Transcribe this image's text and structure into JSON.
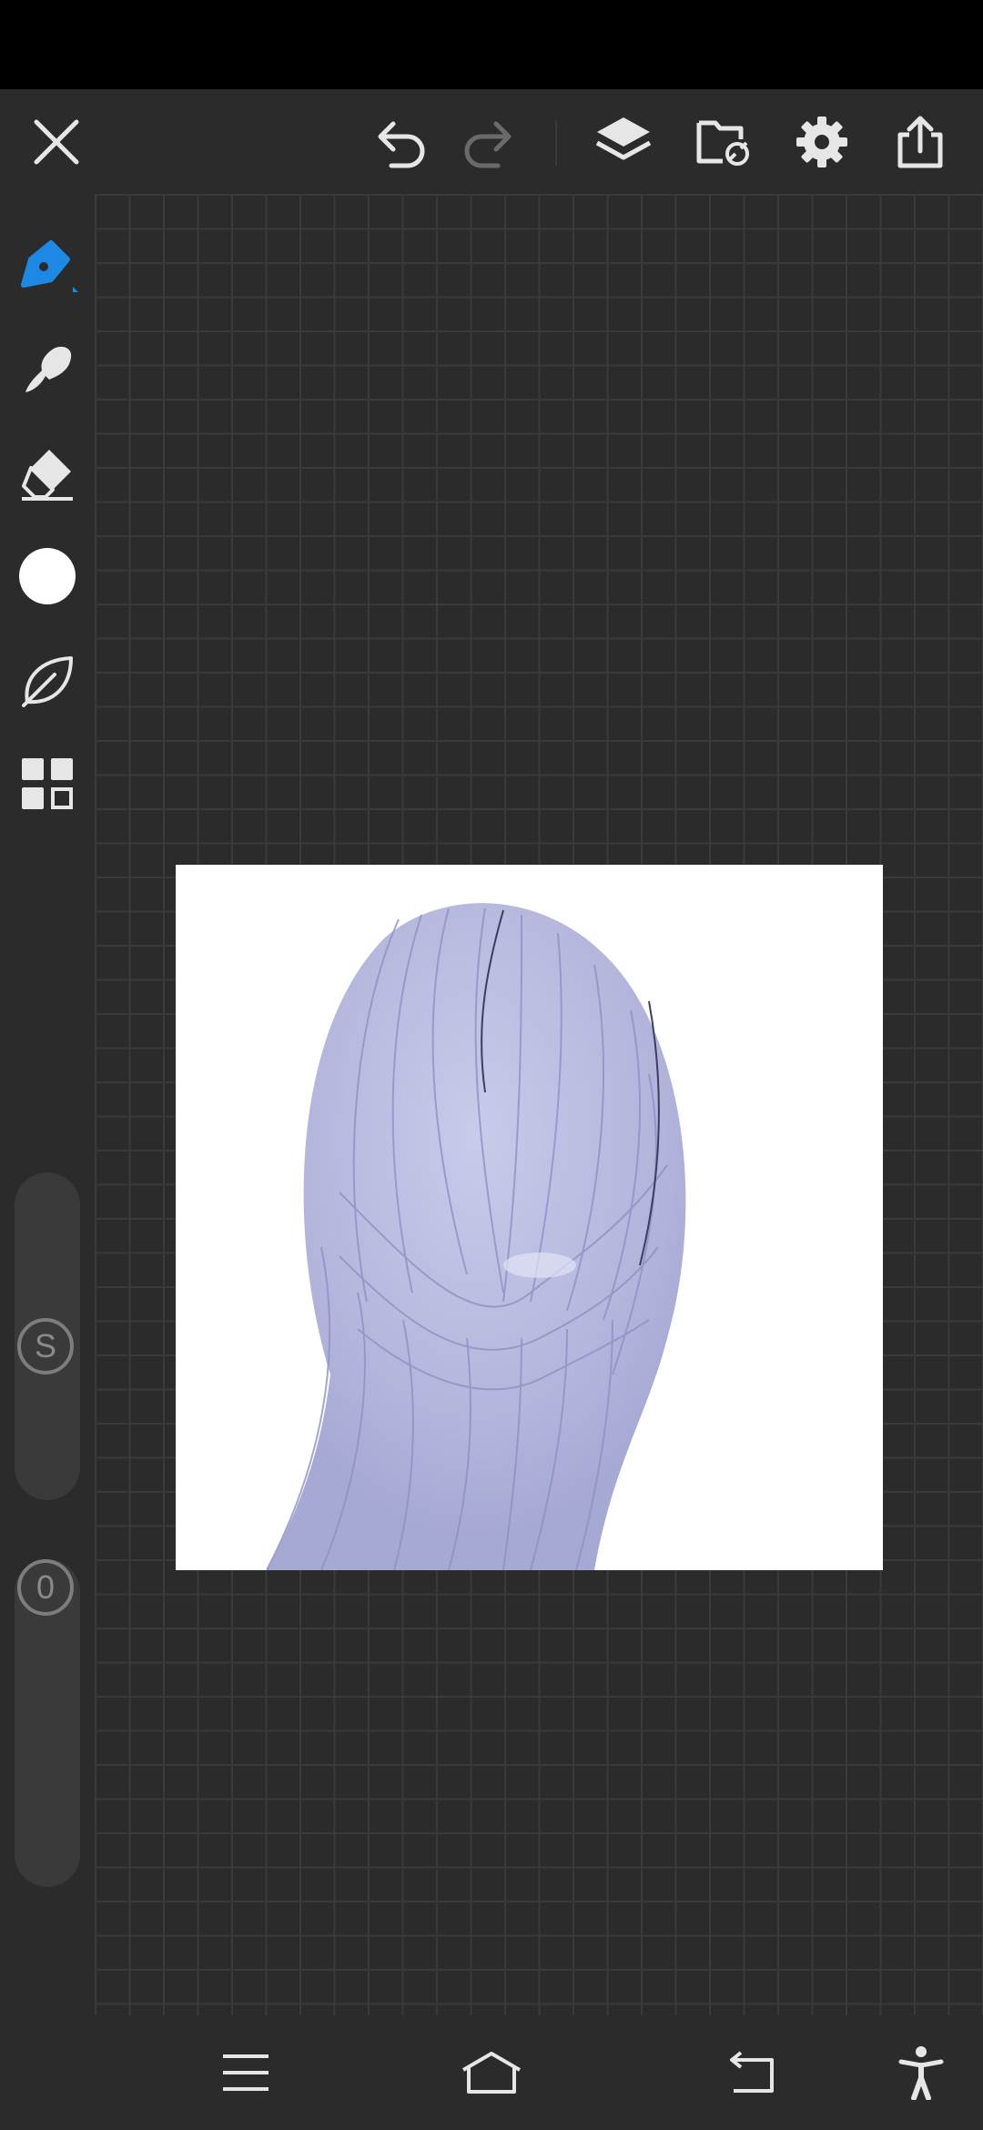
{
  "toolbar": {
    "close": "close-icon",
    "undo": "undo-icon",
    "redo": "redo-icon",
    "layers": "layers-icon",
    "gallery": "gallery-icon",
    "settings": "gear-icon",
    "export": "share-icon"
  },
  "sidebar": {
    "tools": [
      {
        "name": "pen-tool",
        "icon": "pen-icon",
        "active": true
      },
      {
        "name": "smudge-tool",
        "icon": "smudge-icon",
        "active": false
      },
      {
        "name": "eraser-tool",
        "icon": "eraser-icon",
        "active": false
      },
      {
        "name": "color-picker",
        "icon": "color-swatch",
        "active": false
      },
      {
        "name": "brush-library",
        "icon": "leaf-icon",
        "active": false
      },
      {
        "name": "more-tools",
        "icon": "grid-icon",
        "active": false
      }
    ],
    "size_slider": {
      "label": "S"
    },
    "opacity_slider": {
      "label": "0"
    }
  },
  "colors": {
    "accent": "#1e88e5",
    "background": "#2b2b2b",
    "grid": "#3a3a3a",
    "icon": "#e6e6e6",
    "icon_disabled": "#6a6a6a",
    "current_color": "#ffffff",
    "hair": "#b9bbdf"
  },
  "nav": {
    "menu": "menu-icon",
    "home": "home-icon",
    "back": "back-icon",
    "accessibility": "accessibility-icon"
  }
}
